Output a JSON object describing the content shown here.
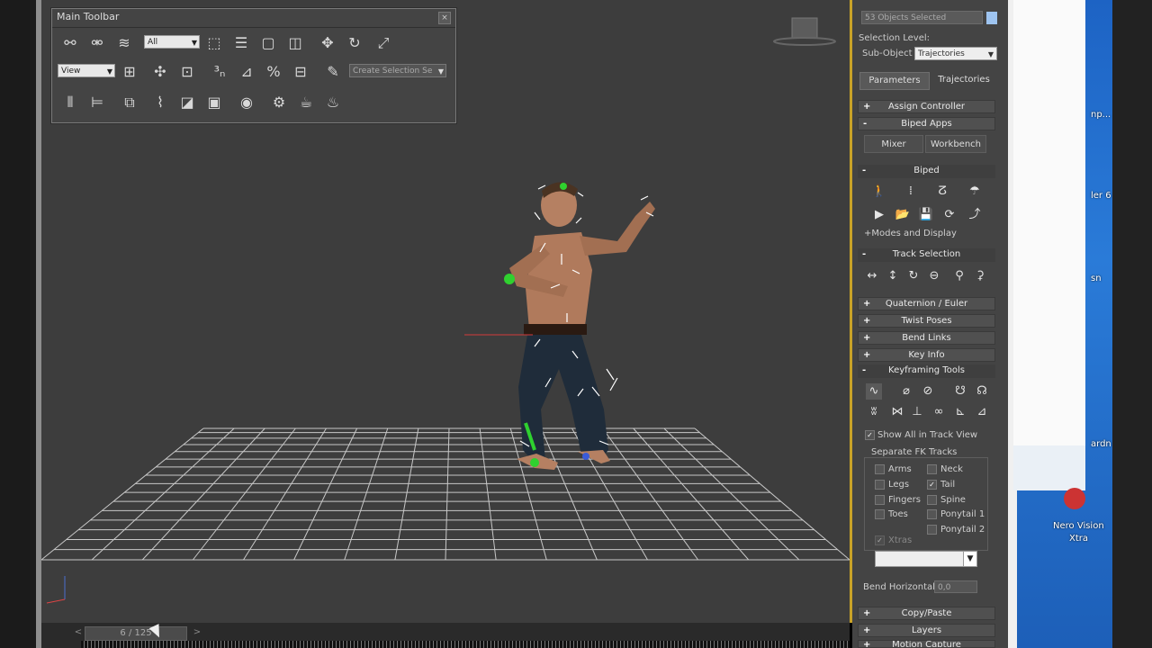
{
  "main_toolbar": {
    "title": "Main Toolbar",
    "selection_filter": "All",
    "ref_coord": "View",
    "named_selection": "Create Selection Se"
  },
  "command_panel": {
    "selection_field": "53 Objects Selected",
    "selection_level_label": "Selection Level:",
    "sub_object_label": "Sub-Object",
    "sub_object_value": "Trajectories",
    "tabs": [
      "Parameters",
      "Trajectories"
    ],
    "rollouts": {
      "assign_controller": "Assign Controller",
      "biped_apps": "Biped Apps",
      "mixer": "Mixer",
      "workbench": "Workbench",
      "biped": "Biped",
      "modes_display": "+Modes and Display",
      "track_selection": "Track Selection",
      "quaternion": "Quaternion / Euler",
      "twist_poses": "Twist Poses",
      "bend_links": "Bend Links",
      "key_info": "Key Info",
      "keyframing_tools": "Keyframing Tools",
      "copy_paste": "Copy/Paste",
      "layers": "Layers",
      "motion_capture": "Motion Capture"
    },
    "show_all_track_view": "Show All in Track View",
    "separate_fk_label": "Separate FK Tracks",
    "fk_tracks": {
      "arms": "Arms",
      "neck": "Neck",
      "legs": "Legs",
      "tail": "Tail",
      "fingers": "Fingers",
      "spine": "Spine",
      "toes": "Toes",
      "ponytail1": "Ponytail 1",
      "ponytail2": "Ponytail 2",
      "xtras": "Xtras"
    },
    "bend_horizontal_label": "Bend Horizontal:",
    "bend_horizontal_value": "0,0"
  },
  "timeline": {
    "frame": "6 / 125"
  },
  "desktop": {
    "icon_label_1": "Nero Vision",
    "icon_label_2": "Xtra",
    "snip_1": "np...",
    "snip_2": "ler 6",
    "snip_3": "sn",
    "snip_4": "ardn"
  },
  "icons": [
    "link-icon",
    "unlink-icon",
    "bind-icon",
    "select-icon",
    "select-by-name-icon",
    "rect-region-icon",
    "window-crossing-icon",
    "move-icon",
    "rotate-icon",
    "scale-icon",
    "pivot-icon",
    "snap-icon",
    "angle-snap-icon",
    "percent-snap-icon",
    "spinner-snap-icon",
    "edit-named-icon",
    "mirror-icon",
    "align-icon",
    "layers-icon",
    "curve-editor-icon",
    "schematic-icon",
    "material-editor-icon",
    "render-setup-icon",
    "render-frame-icon",
    "render-icon",
    "teapot-icon"
  ]
}
